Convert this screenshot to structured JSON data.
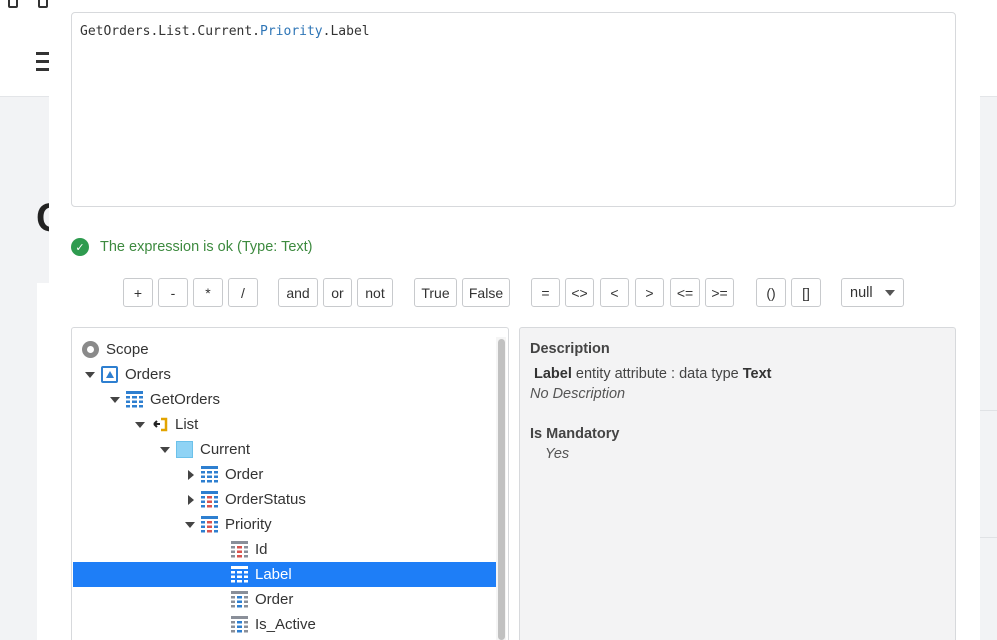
{
  "expression": {
    "part1": "GetOrders.List.Current.",
    "keyword": "Priority",
    "part2": ".Label"
  },
  "status": {
    "icon": "check-circle-icon",
    "message": "The expression is ok (Type: Text)",
    "color": "#3d8a3f"
  },
  "operators": [
    "+",
    "-",
    "*",
    "/",
    "and",
    "or",
    "not",
    "True",
    "False",
    "=",
    "<>",
    "<",
    ">",
    "<=",
    ">=",
    "()",
    "[]"
  ],
  "null_select": {
    "value": "null"
  },
  "tree": {
    "items": [
      {
        "label": "Scope",
        "icon": "scope-icon",
        "toggle": "none"
      },
      {
        "label": "Orders",
        "icon": "screen-icon",
        "toggle": "expanded"
      },
      {
        "label": "GetOrders",
        "icon": "aggregate-icon",
        "toggle": "expanded"
      },
      {
        "label": "List",
        "icon": "list-icon",
        "toggle": "expanded"
      },
      {
        "label": "Current",
        "icon": "record-icon",
        "toggle": "expanded"
      },
      {
        "label": "Order",
        "icon": "entity-icon",
        "toggle": "collapsed"
      },
      {
        "label": "OrderStatus",
        "icon": "static-entity-icon",
        "toggle": "collapsed"
      },
      {
        "label": "Priority",
        "icon": "static-entity-icon",
        "toggle": "expanded"
      },
      {
        "label": "Id",
        "icon": "attribute-icon",
        "toggle": "none"
      },
      {
        "label": "Label",
        "icon": "attribute-icon",
        "toggle": "none",
        "selected": true
      },
      {
        "label": "Order",
        "icon": "attribute-icon",
        "toggle": "none"
      },
      {
        "label": "Is_Active",
        "icon": "attribute-icon",
        "toggle": "none"
      }
    ]
  },
  "description": {
    "heading": "Description",
    "name": "Label",
    "detail": "entity attribute : data type",
    "type": "Text",
    "note": "No Description",
    "mandatory_heading": "Is Mandatory",
    "mandatory_value": "Yes"
  },
  "colors": {
    "selection": "#1e7ef7",
    "ok": "#2e9b4f",
    "keyword": "#2e75b6"
  }
}
